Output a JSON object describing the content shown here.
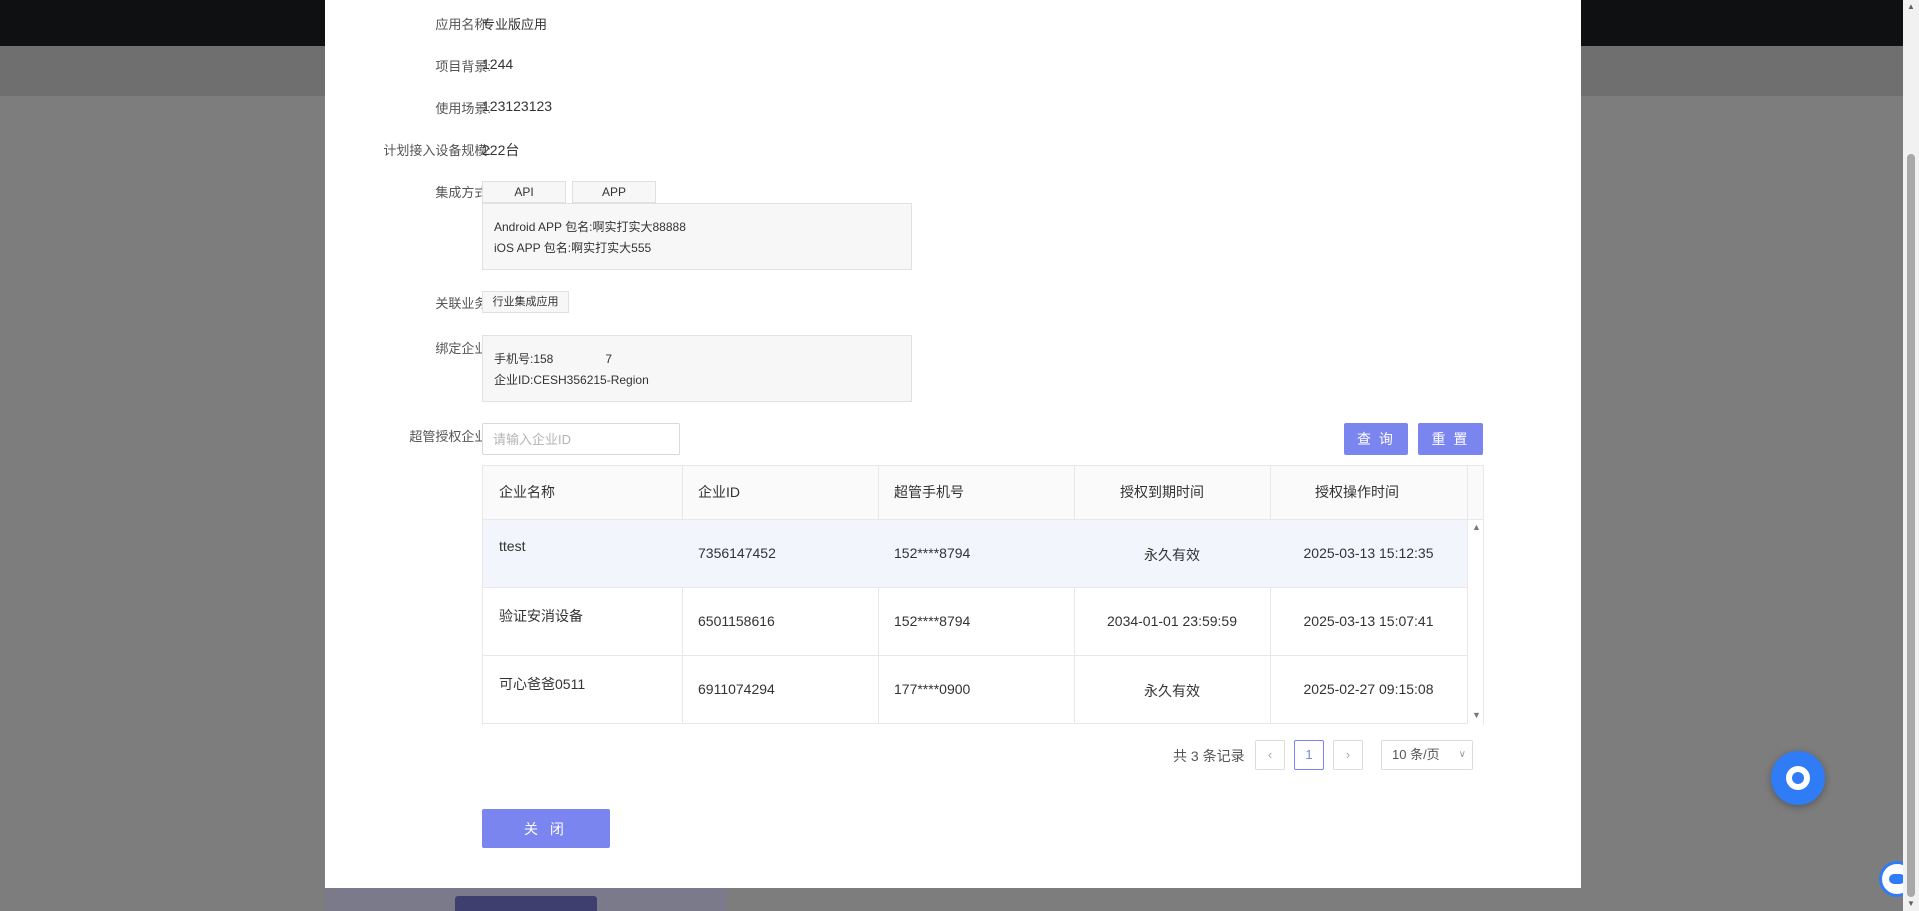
{
  "fields": {
    "app_name": {
      "label": "应用名称:",
      "value": "专业版应用"
    },
    "background": {
      "label": "项目背景:",
      "value": "1244"
    },
    "scenario": {
      "label": "使用场景:",
      "value": "123123123"
    },
    "scale": {
      "label": "计划接入设备规模:",
      "value": "222台"
    },
    "integration": {
      "label": "集成方式:",
      "tags": [
        "API",
        "APP"
      ],
      "android": "Android APP 包名:啊实打实大88888",
      "ios": "iOS APP 包名:啊实打实大555"
    },
    "business": {
      "label": "关联业务:",
      "tag": "行业集成应用"
    },
    "enterprise": {
      "label": "绑定企业:",
      "phone": "手机号:158",
      "phone_tail": "7",
      "enterprise_id": "企业ID:CESH356215-Region"
    },
    "super_auth": {
      "label": "超管授权企业:"
    }
  },
  "search": {
    "placeholder": "请输入企业ID",
    "query_label": "查 询",
    "reset_label": "重 置"
  },
  "table": {
    "headers": [
      "企业名称",
      "企业ID",
      "超管手机号",
      "授权到期时间",
      "授权操作时间"
    ],
    "rows": [
      [
        "ttest",
        "7356147452",
        "152****8794",
        "永久有效",
        "2025-03-13 15:12:35"
      ],
      [
        "验证安消设备",
        "6501158616",
        "152****8794",
        "2034-01-01 23:59:59",
        "2025-03-13 15:07:41"
      ],
      [
        "可心爸爸0511",
        "6911074294",
        "177****0900",
        "永久有效",
        "2025-02-27 09:15:08"
      ]
    ]
  },
  "pagination": {
    "total": "共 3 条记录",
    "prev": "‹",
    "current": "1",
    "next": "›",
    "page_size": "10 条/页"
  },
  "close_label": "关 闭",
  "colors": {
    "accent": "#7b85ef",
    "help": "#2f7cf6"
  }
}
